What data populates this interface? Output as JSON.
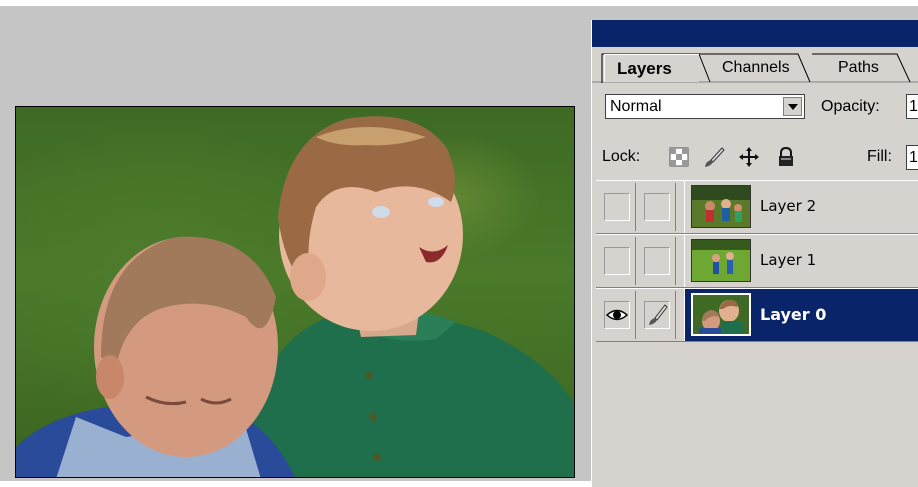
{
  "layers_panel": {
    "tabs": [
      {
        "label": "Layers",
        "active": true
      },
      {
        "label": "Channels",
        "active": false
      },
      {
        "label": "Paths",
        "active": false
      }
    ],
    "blend_mode": {
      "selected": "Normal"
    },
    "opacity": {
      "label": "Opacity:",
      "value": "1"
    },
    "lock": {
      "label": "Lock:",
      "icons": [
        "transparency-icon",
        "brush-icon",
        "move-icon",
        "lock-icon"
      ]
    },
    "fill": {
      "label": "Fill:",
      "value": "1"
    },
    "layers": [
      {
        "name": "Layer 2",
        "visible": false,
        "selected": false
      },
      {
        "name": "Layer 1",
        "visible": false,
        "selected": false
      },
      {
        "name": "Layer 0",
        "visible": true,
        "selected": true
      }
    ],
    "colors": {
      "title_bar": "#0a246a",
      "selection": "#0a246a",
      "panel_bg": "#d6d3ce"
    }
  }
}
